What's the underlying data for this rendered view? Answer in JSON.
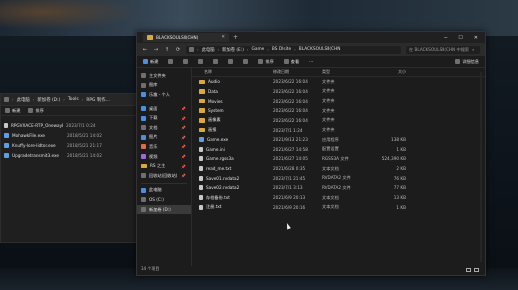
{
  "back_window": {
    "breadcrumb": [
      "此电脑",
      "新加卷 (D:)",
      "Tools",
      "RPG 制作…"
    ],
    "toolbar": {
      "new": "新建",
      "sort": "排序"
    },
    "files": [
      {
        "name": "RPGVXACE-RTP_OnewayEx.Co",
        "date": "2023/7/1 0:24"
      },
      {
        "name": "MohawkFile.exe",
        "date": "2018/5/21 14:02"
      },
      {
        "name": "Knuffy-lore-lidtor.exe",
        "date": "2018/5/21 21:17"
      },
      {
        "name": "Upgradetransmit3.exe",
        "date": "2018/5/21 14:02"
      }
    ]
  },
  "main_window": {
    "tab_title": "BLACKSOULSⅡ(CHN)",
    "breadcrumb": [
      "此电脑",
      "新加卷 (E:)",
      "Game",
      "BS Dlsite",
      "BLACKSOULSⅡ(CHN"
    ],
    "search_placeholder": "在 BLACKSOULSⅡ(CHN 中搜索",
    "toolbar": {
      "new": "新建",
      "sort": "排序",
      "view": "查看",
      "details": "详细信息"
    },
    "nav": {
      "items": [
        {
          "label": "主文件夹",
          "icon": "home-icon",
          "pinned": false
        },
        {
          "label": "图库",
          "icon": "gallery-icon",
          "pinned": false
        },
        {
          "label": "乐趣 - 个人",
          "icon": "cloud-icon",
          "pinned": false
        },
        {
          "label": "桌面",
          "icon": "desktop-icon",
          "pinned": true
        },
        {
          "label": "下载",
          "icon": "download-icon",
          "pinned": true
        },
        {
          "label": "文档",
          "icon": "document-icon",
          "pinned": true
        },
        {
          "label": "图片",
          "icon": "picture-icon",
          "pinned": true
        },
        {
          "label": "音乐",
          "icon": "music-icon",
          "pinned": true
        },
        {
          "label": "视频",
          "icon": "video-icon",
          "pinned": true
        },
        {
          "label": "RS 之主",
          "icon": "folder-icon",
          "pinned": true
        },
        {
          "label": "回收站(回收站)",
          "icon": "recycle-bin-icon",
          "pinned": true
        },
        {
          "label": "此电脑",
          "icon": "pc-icon",
          "pinned": false
        },
        {
          "label": "OS (C:)",
          "icon": "drive-icon",
          "pinned": false
        },
        {
          "label": "新加卷 (D:)",
          "icon": "drive-icon",
          "pinned": false
        }
      ]
    },
    "columns": {
      "name": "名称",
      "date": "修改日期",
      "type": "类型",
      "size": "大小"
    },
    "files": [
      {
        "name": "Audio",
        "date": "2023/6/22 16:04",
        "type": "文件夹",
        "size": "",
        "kind": "folder"
      },
      {
        "name": "Data",
        "date": "2023/6/22 16:04",
        "type": "文件夹",
        "size": "",
        "kind": "folder"
      },
      {
        "name": "Movies",
        "date": "2023/6/22 16:04",
        "type": "文件夹",
        "size": "",
        "kind": "folder"
      },
      {
        "name": "System",
        "date": "2023/6/22 16:04",
        "type": "文件夹",
        "size": "",
        "kind": "folder"
      },
      {
        "name": "画像素",
        "date": "2023/6/22 16:04",
        "type": "文件夹",
        "size": "",
        "kind": "folder"
      },
      {
        "name": "画报",
        "date": "2023/7/1 1:24",
        "type": "文件夹",
        "size": "",
        "kind": "folder"
      },
      {
        "name": "Game.exe",
        "date": "2021/9/13 21:23",
        "type": "应用程序",
        "size": "138 KB",
        "kind": "exe"
      },
      {
        "name": "Game.ini",
        "date": "2021/6/27 14:58",
        "type": "配置设置",
        "size": "1 KB",
        "kind": "file"
      },
      {
        "name": "Game.rgss3a",
        "date": "2021/6/27 14:05",
        "type": "RGSS3A 文件",
        "size": "524,390 KB",
        "kind": "file"
      },
      {
        "name": "read_me.txt",
        "date": "2021/6/28 0:35",
        "type": "文本文档",
        "size": "2 KB",
        "kind": "file"
      },
      {
        "name": "Save01.rvdata2",
        "date": "2023/7/1 21:45",
        "type": "RVDATA2 文件",
        "size": "76 KB",
        "kind": "file"
      },
      {
        "name": "Save02.rvdata2",
        "date": "2023/7/1 3:13",
        "type": "RVDATA2 文件",
        "size": "77 KB",
        "kind": "file"
      },
      {
        "name": "存档备份.txt",
        "date": "2021/6/9 20:13",
        "type": "文本文档",
        "size": "13 KB",
        "kind": "file"
      },
      {
        "name": "注册.txt",
        "date": "2021/6/9 20:16",
        "type": "文本文档",
        "size": "1 KB",
        "kind": "file"
      }
    ],
    "status": "14 个项目"
  }
}
